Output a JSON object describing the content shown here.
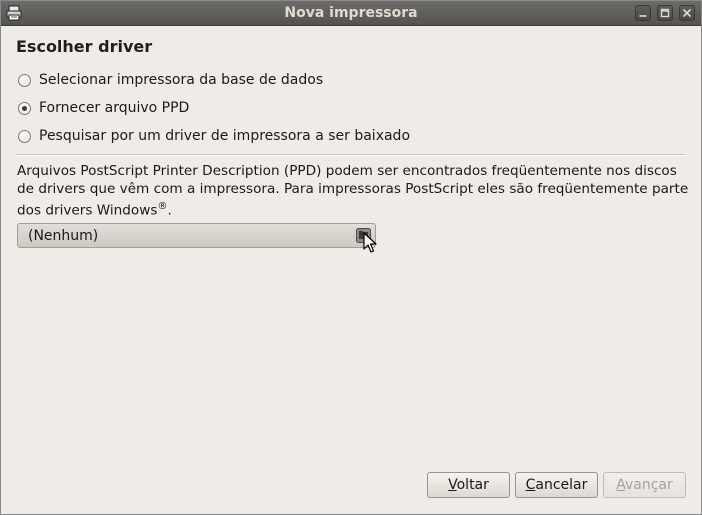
{
  "window": {
    "title": "Nova impressora",
    "icon": "printer-icon",
    "controls": [
      "minimize-icon",
      "maximize-icon",
      "close-icon"
    ]
  },
  "page": {
    "heading": "Escolher driver",
    "options": [
      {
        "label": "Selecionar impressora da base de dados",
        "selected": false
      },
      {
        "label": "Fornecer arquivo PPD",
        "selected": true
      },
      {
        "label": "Pesquisar por um driver de impressora a ser baixado",
        "selected": false
      }
    ],
    "description": {
      "text": "Arquivos PostScript Printer Description (PPD) podem ser encontrados freqüentemente nos discos de drivers que vêm com a impressora. Para impressoras PostScript eles são freqüentemente parte dos drivers Windows",
      "registered_mark": "®",
      "end": "."
    },
    "file_chooser": {
      "value": "(Nenhum)",
      "icon": "folder-icon"
    }
  },
  "buttons": {
    "back": {
      "mnemonic": "V",
      "rest": "oltar"
    },
    "cancel": {
      "mnemonic": "C",
      "rest": "ancelar"
    },
    "forward": {
      "mnemonic": "A",
      "rest": "vançar",
      "enabled": false
    }
  },
  "colors": {
    "titlebar": "#5f5e5a",
    "window_bg": "#efebe7",
    "title_text": "#dfdbd2"
  }
}
